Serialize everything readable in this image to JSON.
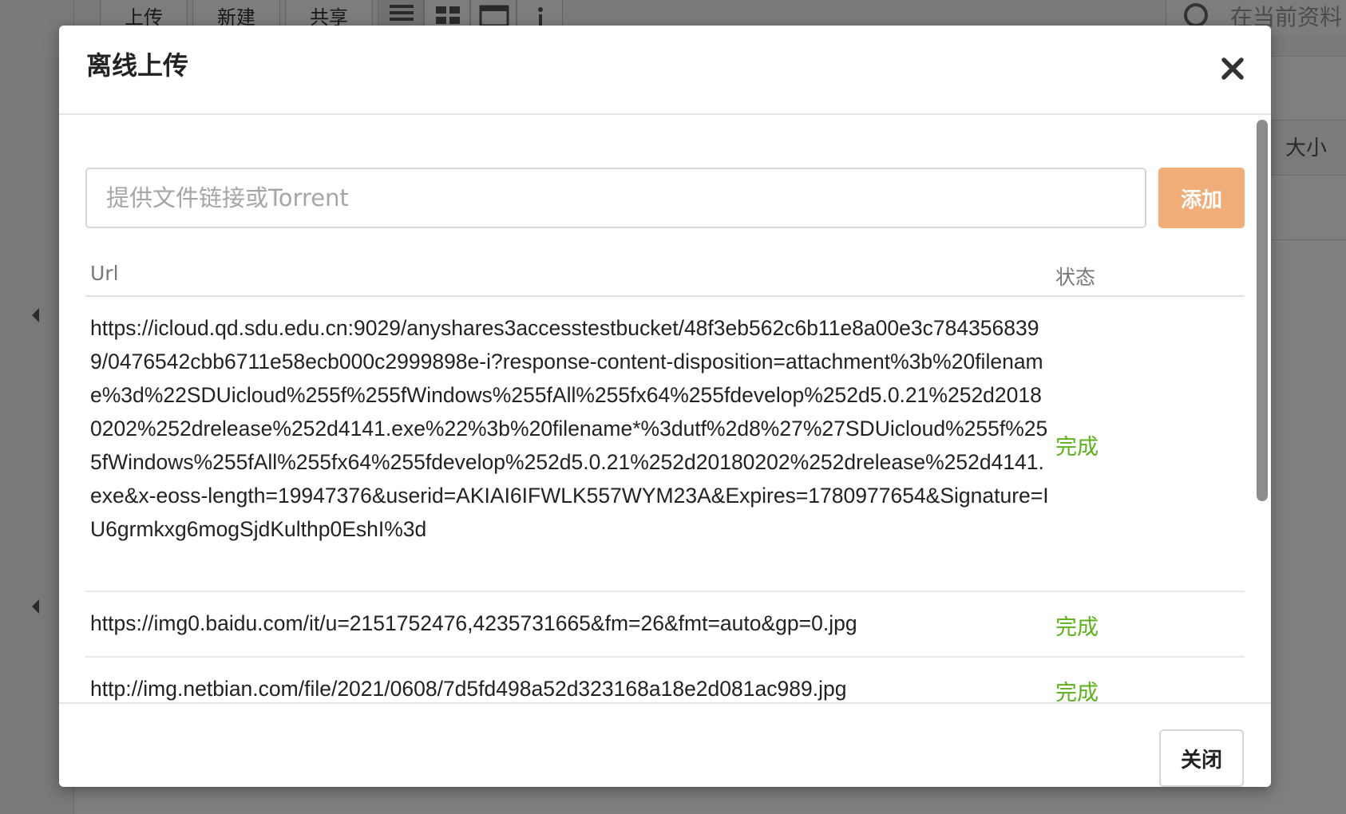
{
  "background": {
    "toolbar_buttons": [
      "上传",
      "新建",
      "共享"
    ],
    "search_placeholder": "在当前资料",
    "size_column": "大小"
  },
  "modal": {
    "title": "离线上传",
    "close_icon": "close-icon",
    "input_placeholder": "提供文件链接或Torrent",
    "add_label": "添加",
    "table": {
      "headers": {
        "url": "Url",
        "status": "状态"
      },
      "rows": [
        {
          "url": "https://icloud.qd.sdu.edu.cn:9029/anyshares3accesstestbucket/48f3eb562c6b11e8a00e3c7843568399/0476542cbb6711e58ecb000c2999898e-i?response-content-disposition=attachment%3b%20filename%3d%22SDUicloud%255f%255fWindows%255fAll%255fx64%255fdevelop%252d5.0.21%252d20180202%252drelease%252d4141.exe%22%3b%20filename*%3dutf%2d8%27%27SDUicloud%255f%255fWindows%255fAll%255fx64%255fdevelop%252d5.0.21%252d20180202%252drelease%252d4141.exe&x-eoss-length=19947376&userid=AKIAI6IFWLK557WYM23A&Expires=1780977654&Signature=IU6grmkxg6mogSjdKulthp0EshI%3d",
          "status": "完成"
        },
        {
          "url": "https://img0.baidu.com/it/u=2151752476,4235731665&fm=26&fmt=auto&gp=0.jpg",
          "status": "完成"
        },
        {
          "url": "http://img.netbian.com/file/2021/0608/7d5fd498a52d323168a18e2d081ac989.jpg",
          "status": "完成"
        }
      ]
    },
    "close_button_label": "关闭"
  },
  "colors": {
    "accent_button": "#f0ad78",
    "status_done": "#5cb21a"
  }
}
